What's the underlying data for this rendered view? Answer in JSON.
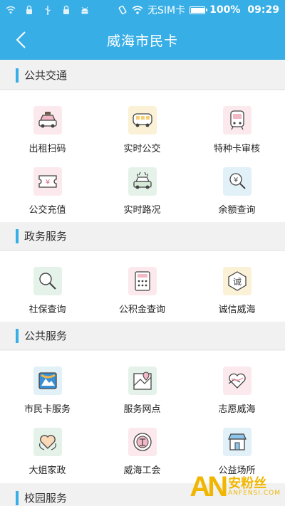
{
  "status_bar": {
    "carrier": "无SIM卡",
    "battery": "100%",
    "battery_level": 1.0,
    "time": "09:29"
  },
  "header": {
    "title": "威海市民卡"
  },
  "sections": [
    {
      "title": "公共交通",
      "items": [
        {
          "label": "出租扫码",
          "icon": "taxi-icon"
        },
        {
          "label": "实时公交",
          "icon": "bus-icon"
        },
        {
          "label": "特种卡审核",
          "icon": "train-icon"
        },
        {
          "label": "公交充值",
          "icon": "ticket-icon"
        },
        {
          "label": "实时路况",
          "icon": "car-icon"
        },
        {
          "label": "余额查询",
          "icon": "coin-search-icon"
        }
      ]
    },
    {
      "title": "政务服务",
      "items": [
        {
          "label": "社保查询",
          "icon": "magnifier-icon"
        },
        {
          "label": "公积金查询",
          "icon": "calculator-icon"
        },
        {
          "label": "诚信威海",
          "icon": "integrity-icon",
          "icon_text": "诚"
        }
      ]
    },
    {
      "title": "公共服务",
      "items": [
        {
          "label": "市民卡服务",
          "icon": "citizen-card-icon"
        },
        {
          "label": "服务网点",
          "icon": "map-pin-icon"
        },
        {
          "label": "志愿威海",
          "icon": "heart-hand-icon"
        },
        {
          "label": "大姐家政",
          "icon": "heart-icon"
        },
        {
          "label": "威海工会",
          "icon": "union-emblem-icon"
        },
        {
          "label": "公益场所",
          "icon": "store-icon"
        }
      ]
    },
    {
      "title": "校园服务",
      "items": []
    }
  ],
  "watermark": {
    "logo": "AN",
    "cn": "安粉丝",
    "en": "ANFENSI.COM"
  }
}
